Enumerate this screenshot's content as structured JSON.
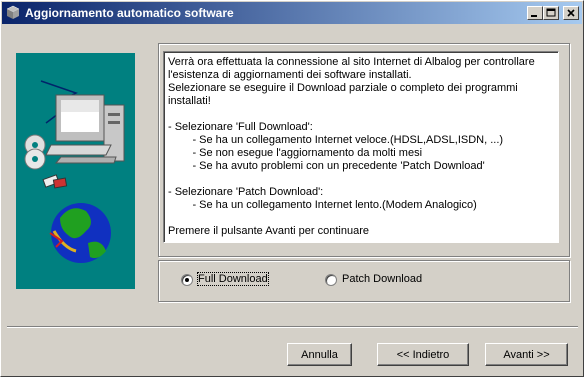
{
  "window": {
    "title": "Aggiornamento automatico software",
    "controls": [
      "minimize",
      "maximize",
      "close"
    ]
  },
  "info_text": "Verrà ora effettuata la connessione al sito Internet di Albalog per controllare\nl'esistenza di aggiornamenti dei software installati.\nSelezionare se eseguire il Download parziale o completo dei programmi\ninstallati!\n\n- Selezionare 'Full Download':\n        - Se ha un collegamento Internet veloce.(HDSL,ADSL,ISDN, ...)\n        - Se non esegue l'aggiornamento da molti mesi\n        - Se ha avuto problemi con un precedente 'Patch Download'\n\n- Selezionare 'Patch Download':\n        - Se ha un collegamento Internet lento.(Modem Analogico)\n\nPremere il pulsante Avanti per continuare",
  "options": {
    "full_download": {
      "label": "Full Download",
      "selected": true
    },
    "patch_download": {
      "label": "Patch Download",
      "selected": false
    }
  },
  "buttons": {
    "cancel": "Annulla",
    "back": "<< Indietro",
    "next": "Avanti >>"
  },
  "colors": {
    "title_start": "#0a246a",
    "title_end": "#a6caf0",
    "dialog_bg": "#d4d0c8",
    "image_bg": "#008080"
  },
  "icons": [
    "app-icon",
    "computer-illustration",
    "globe-illustration",
    "cd-illustration"
  ]
}
